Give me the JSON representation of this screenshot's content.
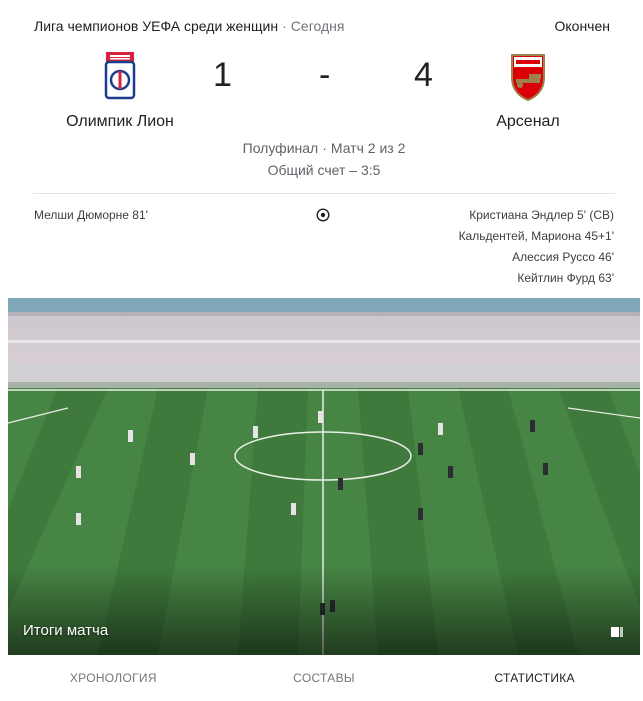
{
  "header": {
    "competition": "Лига чемпионов УЕФА среди женщин",
    "separator": "·",
    "date": "Сегодня",
    "status": "Окончен"
  },
  "match": {
    "home": {
      "name": "Олимпик Лион",
      "score": "1",
      "logo_icon": "olympique-lyonnais-crest"
    },
    "away": {
      "name": "Арсенал",
      "score": "4",
      "logo_icon": "arsenal-crest"
    },
    "score_separator": "-",
    "stage": "Полуфинал",
    "stage_separator": "·",
    "leg": "Матч 2 из 2",
    "aggregate": "Общий счет – 3:5"
  },
  "scorers": {
    "home": [
      "Мелши Дюморне 81'"
    ],
    "away": [
      "Кристиана Эндлер 5' (СВ)",
      "Кальдентей, Мариона 45+1'",
      "Алессия Руссо 46'",
      "Кейтлин Фурд 63'"
    ],
    "ball_icon": "soccer-ball-icon"
  },
  "video": {
    "label": "Итоги матча",
    "icon": "video-play-icon"
  },
  "tabs": [
    {
      "label": "ХРОНОЛОГИЯ",
      "active": false
    },
    {
      "label": "СОСТАВЫ",
      "active": false
    },
    {
      "label": "СТАТИСТИКА",
      "active": true
    }
  ],
  "colors": {
    "lyon_blue": "#1a3e8c",
    "lyon_red": "#d6243d",
    "arsenal_red": "#db0007",
    "arsenal_gold": "#9c824a",
    "pitch_green": "#3f7a3c"
  }
}
